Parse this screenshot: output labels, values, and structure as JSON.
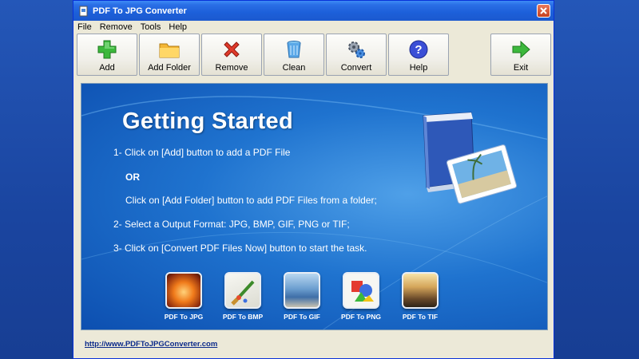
{
  "window": {
    "title": "PDF To JPG Converter"
  },
  "menu": [
    "File",
    "Remove",
    "Tools",
    "Help"
  ],
  "toolbar": {
    "add": "Add",
    "add_folder": "Add Folder",
    "remove": "Remove",
    "clean": "Clean",
    "convert": "Convert",
    "help": "Help",
    "exit": "Exit"
  },
  "getting_started": {
    "title": "Getting Started",
    "step1": "1- Click on [Add] button to add a PDF File",
    "or": "OR",
    "step1b": "Click on [Add Folder] button to add PDF Files from a folder;",
    "step2": "2- Select a Output Format: JPG, BMP, GIF, PNG or TIF;",
    "step3": "3- Click on [Convert PDF Files Now] button to start the task."
  },
  "formats": [
    {
      "label": "PDF To JPG",
      "icon": "jpg-format-icon"
    },
    {
      "label": "PDF To BMP",
      "icon": "bmp-format-icon"
    },
    {
      "label": "PDF To GIF",
      "icon": "gif-format-icon"
    },
    {
      "label": "PDF To PNG",
      "icon": "png-format-icon"
    },
    {
      "label": "PDF To TIF",
      "icon": "tif-format-icon"
    }
  ],
  "footer": {
    "link": "http://www.PDFToJPGConverter.com"
  },
  "colors": {
    "titlebar": "#1c5fd9",
    "content_bg": "#1f73cf",
    "desktop": "#1d4aa8"
  }
}
